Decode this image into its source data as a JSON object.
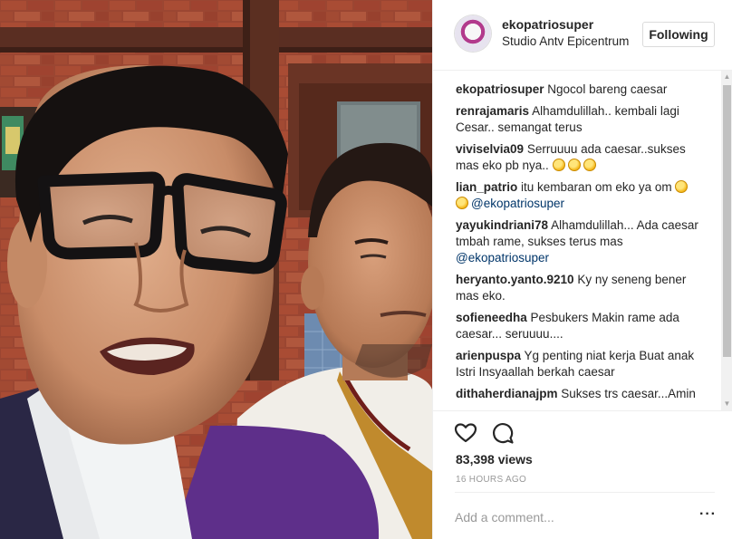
{
  "post": {
    "username": "ekopatriosuper",
    "location": "Studio Antv Epicentrum",
    "follow_label": "Following"
  },
  "comments": [
    {
      "user": "ekopatriosuper",
      "text": "Ngocol bareng caesar"
    },
    {
      "user": "renrajamaris",
      "text": "Alhamdulillah.. kembali lagi Cesar.. semangat terus"
    },
    {
      "user": "viviselvia09",
      "text": "Serruuuu ada caesar..sukses mas eko pb nya.."
    },
    {
      "user": "lian_patrio",
      "text": "itu kembaran om eko ya om",
      "mention": "@ekopatriosuper"
    },
    {
      "user": "yayukindriani78",
      "text": "Alhamdulillah... Ada caesar tmbah rame, sukses terus mas",
      "mention": "@ekopatriosuper"
    },
    {
      "user": "heryanto.yanto.9210",
      "text": "Ky ny seneng bener mas eko."
    },
    {
      "user": "sofieneedha",
      "text": "Pesbukers Makin rame ada caesar... seruuuu...."
    },
    {
      "user": "arienpuspa",
      "text": "Yg penting niat kerja Buat anak Istri Insyaallah berkah caesar"
    },
    {
      "user": "dithaherdianajpm",
      "text": "Sukses trs caesar...Amin"
    }
  ],
  "icons": {
    "like": "heart-icon",
    "comment": "comment-icon",
    "more": "more-options-icon",
    "emoji": "smiley-emoji-icon",
    "grin": "grin-emoji-icon"
  },
  "stats": {
    "views": "83,398 views",
    "time": "16 HOURS AGO"
  },
  "composer": {
    "placeholder": "Add a comment..."
  },
  "colors": {
    "text": "#262626",
    "mention": "#003569",
    "muted": "#999999",
    "border": "#efefef"
  }
}
